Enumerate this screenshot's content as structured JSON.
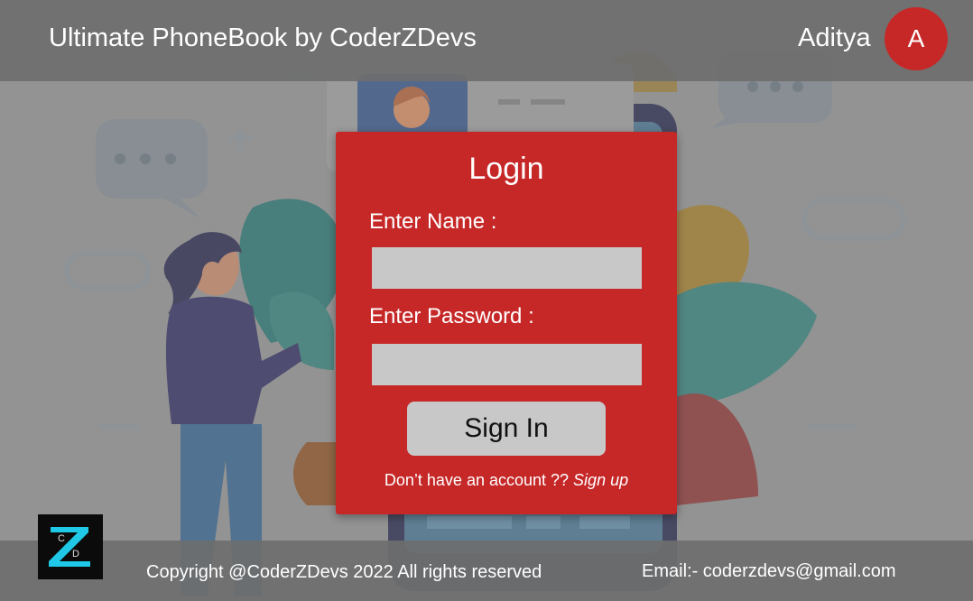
{
  "header": {
    "title": "Ultimate PhoneBook by CoderZDevs",
    "user_name": "Aditya",
    "avatar_initial": "A"
  },
  "login": {
    "title": "Login",
    "name_label": "Enter Name :",
    "name_placeholder": "",
    "password_label": "Enter Password :",
    "password_placeholder": "",
    "sign_in_label": "Sign In",
    "signup_prompt": "Don’t have an account ?? ",
    "signup_link": "Sign up"
  },
  "footer": {
    "copyright": "Copyright @CoderZDevs 2022 All rights reserved",
    "email": "Email:- coderzdevs@gmail.com"
  },
  "logo": {
    "letter_top": "C",
    "letter_main": "Z",
    "letter_bottom": "D"
  },
  "colors": {
    "accent_red": "#c62828",
    "input_gray": "#c8c8c8",
    "bar_gray": "#6e6e6e",
    "logo_cyan": "#1ec8e6"
  },
  "icons": [
    "chat-bubble-icon",
    "person-illustration",
    "phone-illustration",
    "leaf-illustration"
  ]
}
